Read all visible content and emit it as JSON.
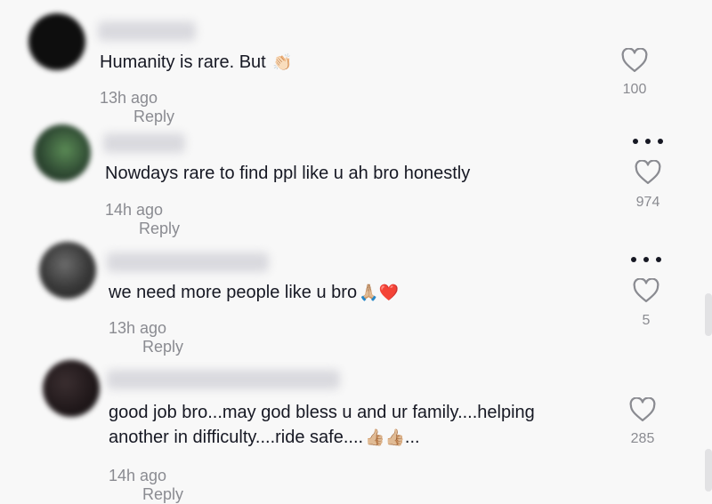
{
  "comments": [
    {
      "text": "Humanity is rare. But",
      "emoji": "👏🏻",
      "time": "13h ago",
      "reply": "Reply",
      "likes": "100",
      "avatar_color": "#111111"
    },
    {
      "text": "Nowdays rare to find ppl like u ah bro honestly",
      "emoji": "",
      "time": "14h ago",
      "reply": "Reply",
      "likes": "974",
      "avatar_color": "#3d5a3f"
    },
    {
      "text": "we need more people like u bro",
      "emoji": "🙏🏼❤️",
      "time": "13h ago",
      "reply": "Reply",
      "likes": "5",
      "avatar_color": "#3a3a3a"
    },
    {
      "text_line1": "good job bro...may god bless u and ur family....helping",
      "text_line2": "another in difficulty....ride safe....",
      "emoji": "👍🏼👍🏼",
      "text_tail": "...",
      "time": "14h ago",
      "reply": "Reply",
      "likes": "285",
      "avatar_color": "#2a2224"
    }
  ]
}
